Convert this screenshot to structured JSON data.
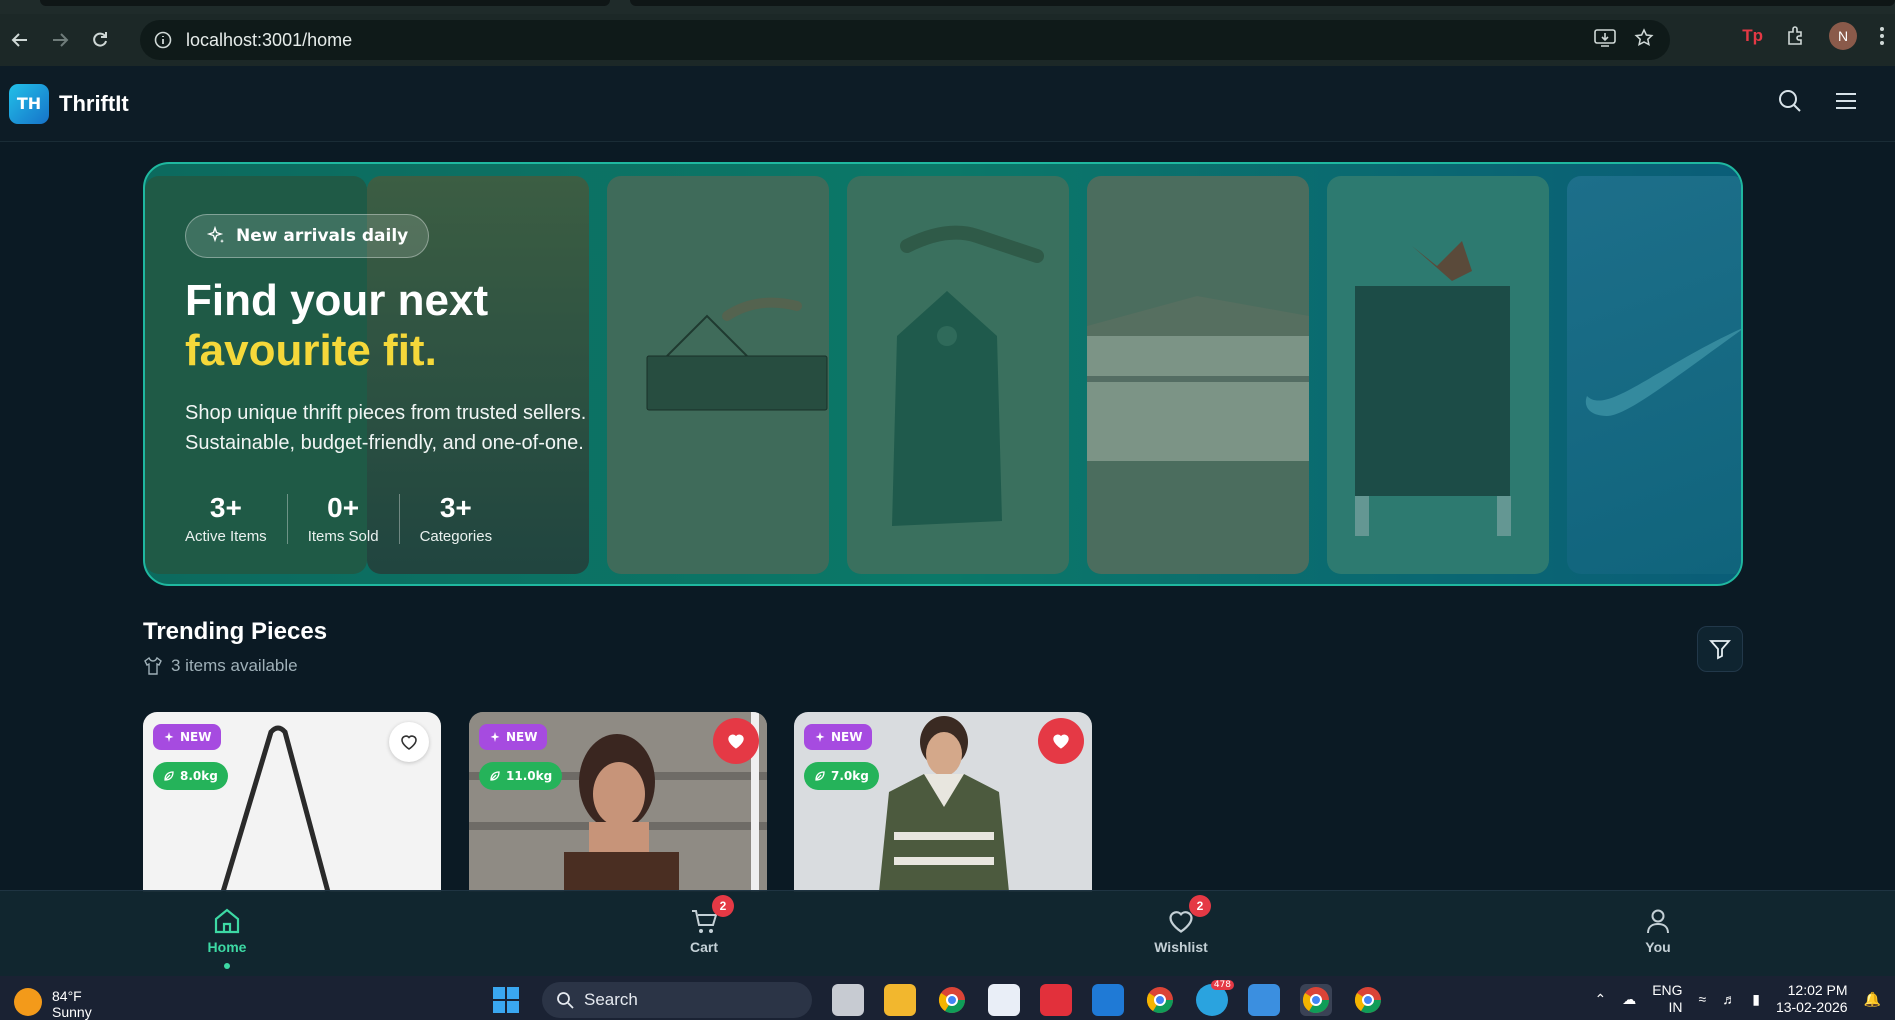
{
  "browser": {
    "url": "localhost:3001/home",
    "profile_initial": "N",
    "ext_label": "Tp"
  },
  "app": {
    "logo_initials": "TH",
    "name": "ThriftIt"
  },
  "hero": {
    "pill_label": "New arrivals daily",
    "title_line1": "Find your next",
    "title_line2": "favourite fit.",
    "subtitle_line1": "Shop unique thrift pieces from trusted sellers.",
    "subtitle_line2": "Sustainable, budget-friendly, and one-of-one.",
    "stats": [
      {
        "value": "3+",
        "label": "Active Items"
      },
      {
        "value": "0+",
        "label": "Items Sold"
      },
      {
        "value": "3+",
        "label": "Categories"
      }
    ]
  },
  "trending": {
    "title": "Trending Pieces",
    "count_text": "3 items available",
    "cards": [
      {
        "badge": "NEW",
        "weight": "8.0kg",
        "wishlisted": false
      },
      {
        "badge": "NEW",
        "weight": "11.0kg",
        "wishlisted": true
      },
      {
        "badge": "NEW",
        "weight": "7.0kg",
        "wishlisted": true
      }
    ]
  },
  "bottom_nav": [
    {
      "label": "Home",
      "icon": "home-icon",
      "active": true
    },
    {
      "label": "Cart",
      "icon": "cart-icon",
      "count": "2"
    },
    {
      "label": "Wishlist",
      "icon": "heart-icon",
      "count": "2"
    },
    {
      "label": "You",
      "icon": "user-icon"
    }
  ],
  "taskbar": {
    "temp": "84°F",
    "condition": "Sunny",
    "search_label": "Search",
    "lang_line1": "ENG",
    "lang_line2": "IN",
    "time": "12:02 PM",
    "date": "13-02-2026",
    "telegram_count": "478"
  },
  "colors": {
    "accent_yellow": "#f5d83a",
    "active_green": "#3dd9a4",
    "badge_purple": "#a64be0",
    "badge_green": "#25b35a",
    "heart_red": "#e53945"
  }
}
